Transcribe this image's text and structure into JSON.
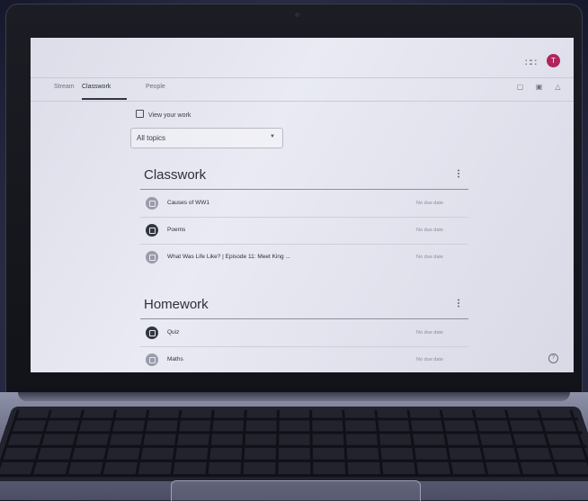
{
  "topbar": {
    "apps_icon": "apps-grid-icon",
    "avatar_letter": "T",
    "avatar_color": "#b2255a"
  },
  "tabs": [
    {
      "label": "Stream"
    },
    {
      "label": "Classwork",
      "active": true
    },
    {
      "label": "People"
    }
  ],
  "toolbar_icons": [
    "meet-icon",
    "calendar-icon",
    "drive-icon"
  ],
  "view_your_work": "View your work",
  "topic_filter": {
    "value": "All topics"
  },
  "sections": [
    {
      "title": "Classwork",
      "items": [
        {
          "title": "Causes of WW1",
          "due": "No due date",
          "icon": "assignment-icon",
          "dark": false
        },
        {
          "title": "Poems",
          "due": "No due date",
          "icon": "assignment-icon",
          "dark": true
        },
        {
          "title": "What Was Life Like? | Episode 11: Meet King ...",
          "due": "No due date",
          "icon": "assignment-icon",
          "dark": false
        }
      ]
    },
    {
      "title": "Homework",
      "items": [
        {
          "title": "Quiz",
          "due": "No due date",
          "icon": "assignment-icon",
          "dark": true
        },
        {
          "title": "Maths",
          "due": "No due date",
          "icon": "assignment-icon",
          "dark": false
        }
      ]
    }
  ],
  "help_icon": "help-icon"
}
